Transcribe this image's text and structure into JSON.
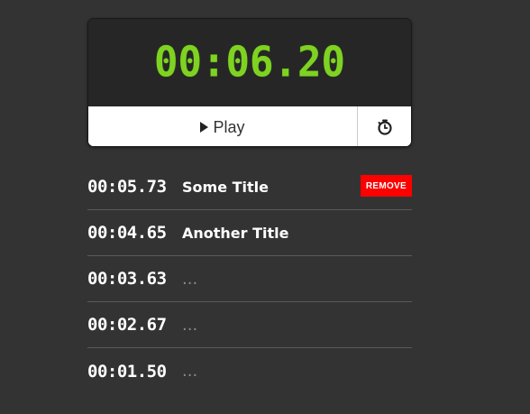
{
  "stopwatch": {
    "display_time": "00:06.20",
    "play_label": "Play",
    "lap_icon": "stopwatch-icon",
    "accent_color": "#7ed321"
  },
  "laps": [
    {
      "time": "00:05.73",
      "title": "Some Title",
      "placeholder": false,
      "remove_label": "REMOVE"
    },
    {
      "time": "00:04.65",
      "title": "Another Title",
      "placeholder": false
    },
    {
      "time": "00:03.63",
      "title": "...",
      "placeholder": true
    },
    {
      "time": "00:02.67",
      "title": "...",
      "placeholder": true
    },
    {
      "time": "00:01.50",
      "title": "...",
      "placeholder": true
    }
  ],
  "colors": {
    "background": "#333333",
    "display_bg": "#262626",
    "remove": "#ff0000"
  }
}
